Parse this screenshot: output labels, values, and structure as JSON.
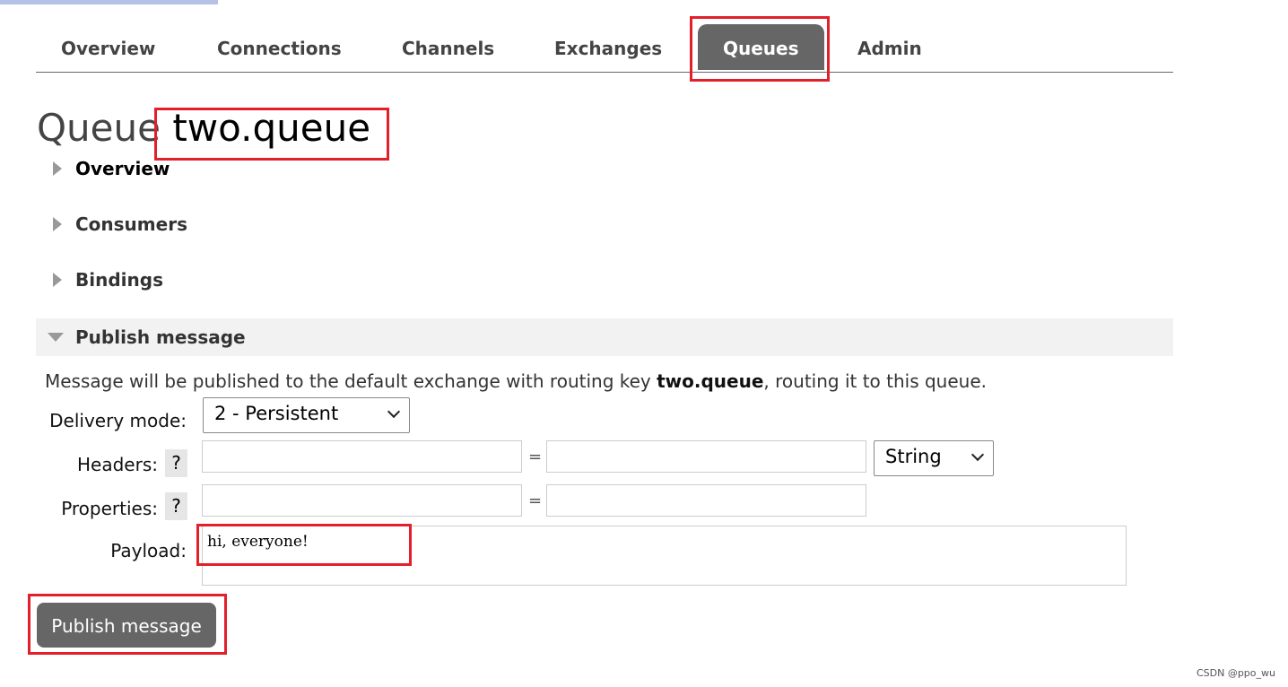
{
  "nav": {
    "tabs": [
      {
        "label": "Overview"
      },
      {
        "label": "Connections"
      },
      {
        "label": "Channels"
      },
      {
        "label": "Exchanges"
      },
      {
        "label": "Queues",
        "active": true
      },
      {
        "label": "Admin"
      }
    ]
  },
  "page": {
    "title_prefix": "Queue",
    "queue_name": "two.queue"
  },
  "sections": [
    {
      "label": "Overview"
    },
    {
      "label": "Consumers"
    },
    {
      "label": "Bindings"
    },
    {
      "label": "Publish message",
      "expanded": true
    }
  ],
  "publish": {
    "info_before": "Message will be published to the default exchange with routing key ",
    "info_key": "two.queue",
    "info_after": ", routing it to this queue.",
    "delivery_label": "Delivery mode:",
    "delivery_value": "2 - Persistent",
    "headers_label": "Headers:",
    "properties_label": "Properties:",
    "help": "?",
    "eq": "=",
    "header_type": "String",
    "payload_label": "Payload:",
    "payload_value": "hi, everyone!",
    "button": "Publish message"
  },
  "watermark": "CSDN @ppo_wu",
  "colors": {
    "annotation": "#e3202a",
    "active_tab": "#666666"
  }
}
